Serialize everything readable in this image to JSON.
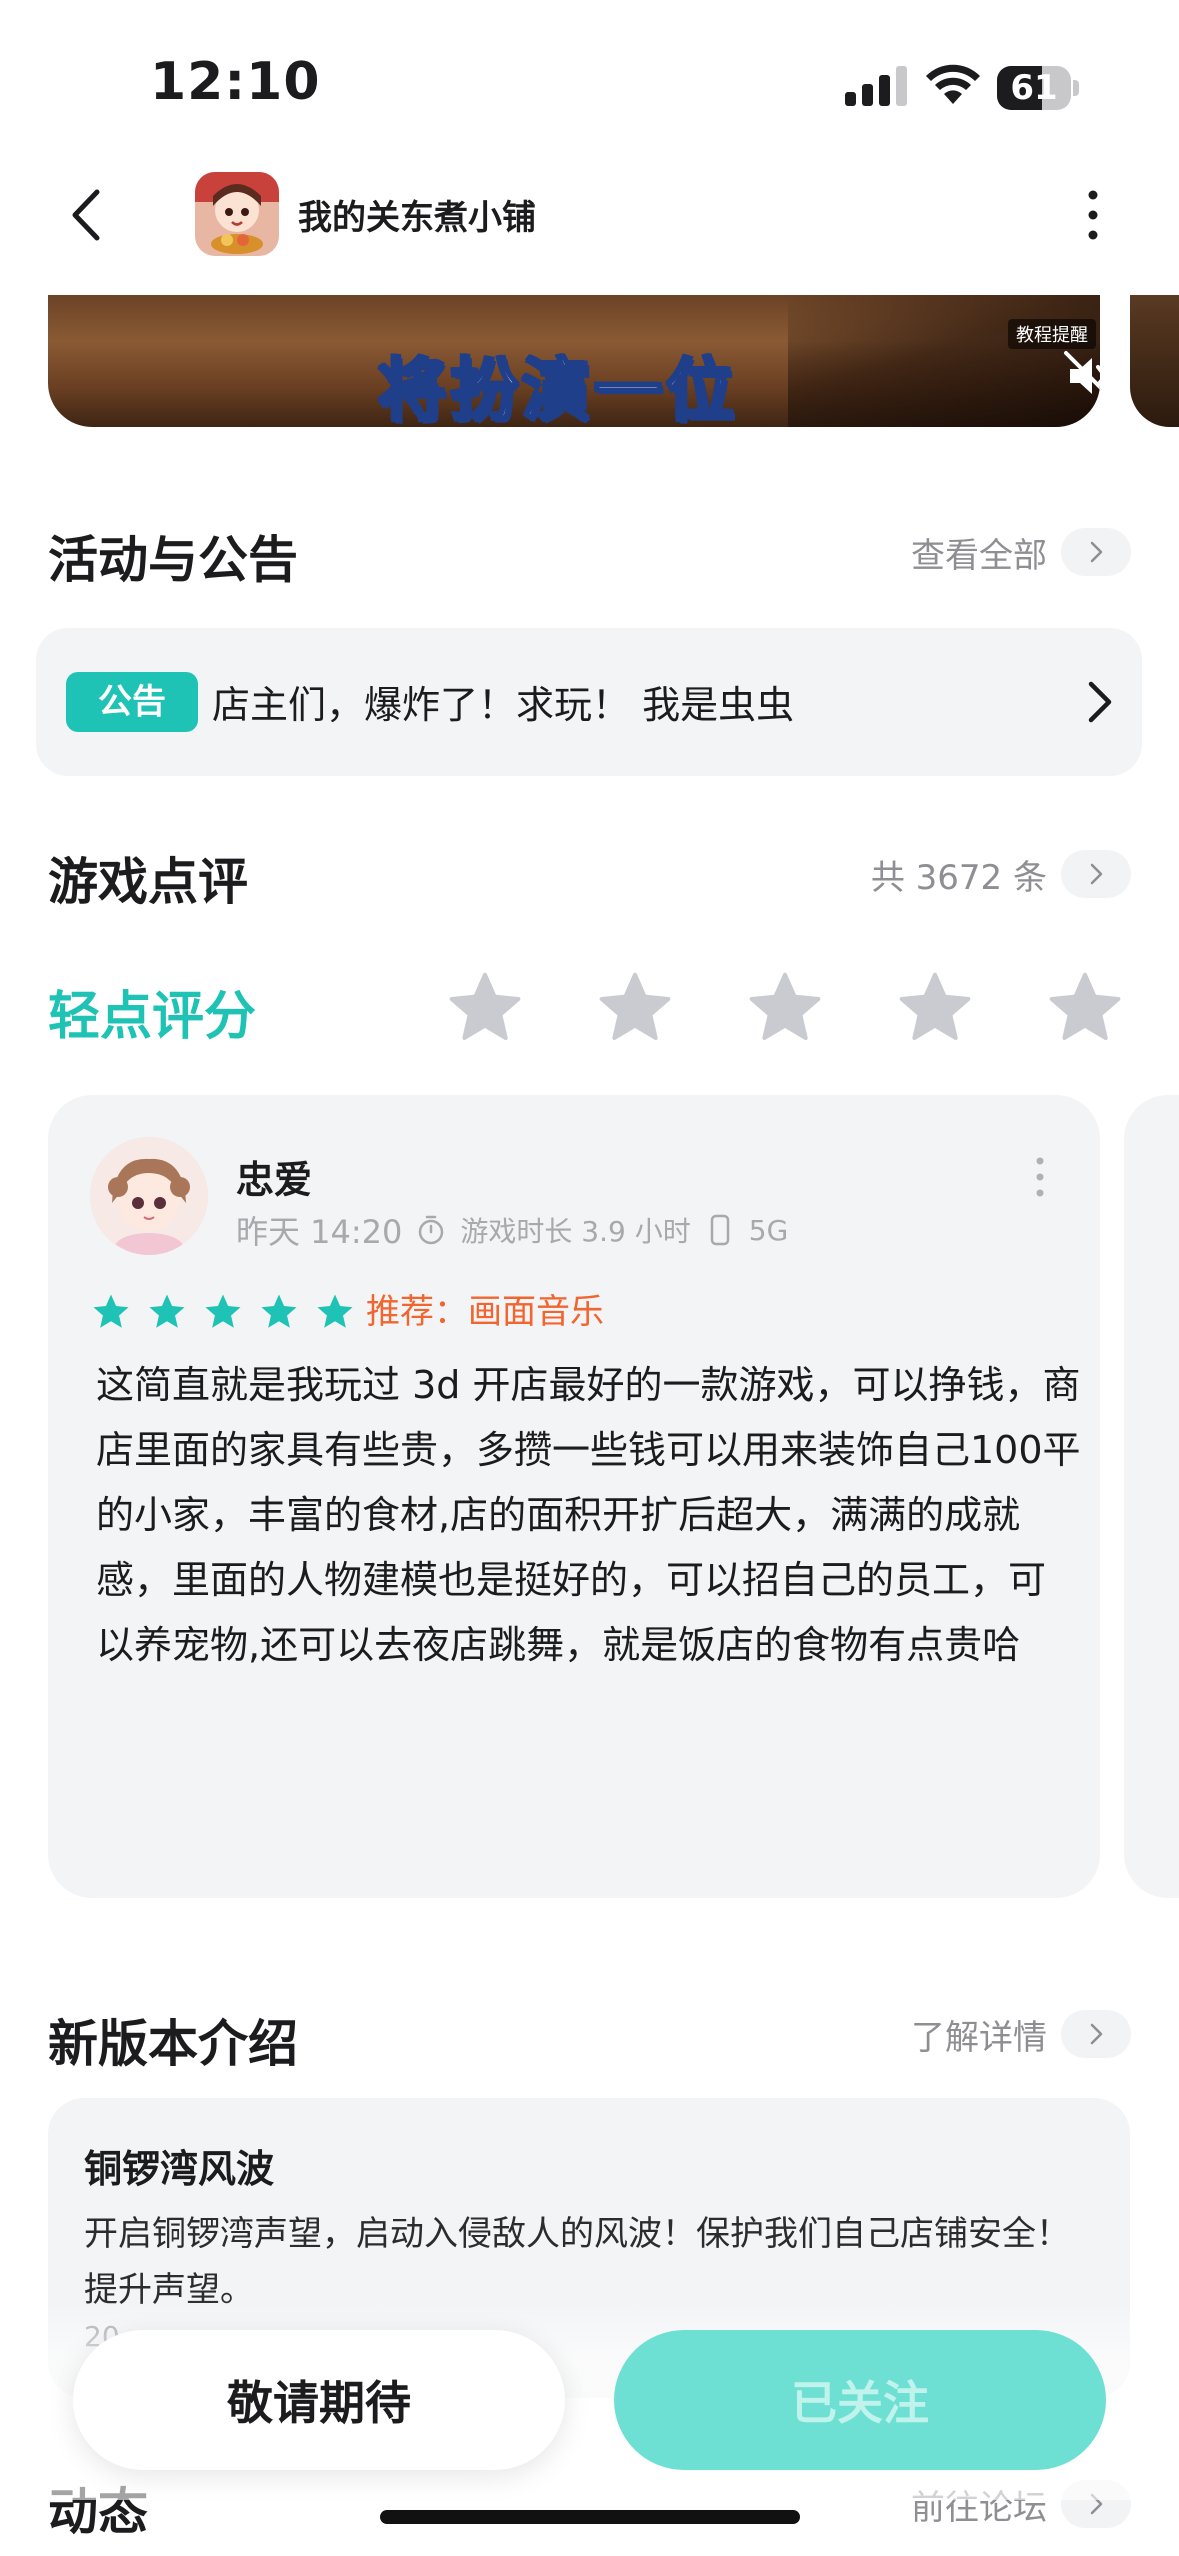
{
  "status_bar": {
    "time": "12:10",
    "battery_level": "61"
  },
  "nav": {
    "title": "我的关东煮小铺"
  },
  "banner": {
    "caption": "将扮演一位",
    "tag": "教程提醒"
  },
  "activities": {
    "title": "活动与公告",
    "link": "查看全部",
    "notice_badge": "公告",
    "notice_text": "店主们，爆炸了！求玩！ 我是虫虫"
  },
  "reviews": {
    "title": "游戏点评",
    "count": "共 3672 条",
    "rate_label": "轻点评分",
    "card": {
      "name": "忠爱",
      "time": "昨天 14:20",
      "playtime": "游戏时长 3.9 小时",
      "device": "5G",
      "stars": 5,
      "recommend": "推荐：画面音乐",
      "body": "这简直就是我玩过 3d 开店最好的一款游戏，可以挣钱，商店里面的家具有些贵，多攒一些钱可以用来装饰自己100平的小家，丰富的食材,店的面积开扩后超大，满满的成就感，里面的人物建模也是挺好的，可以招自己的员工，可以养宠物,还可以去夜店跳舞，就是饭店的食物有点贵哈"
    }
  },
  "version": {
    "title": "新版本介绍",
    "link": "了解详情",
    "card_title": "铜锣湾风波",
    "card_desc": "开启铜锣湾声望，启动入侵敌人的风波！保护我们自己店铺安全！提升声望。",
    "card_date": "20"
  },
  "feed": {
    "title": "动态",
    "link": "前往论坛"
  },
  "actions": {
    "wait_label": "敬请期待",
    "follow_label": "已关注"
  },
  "colors": {
    "accent": "#1fc3b5",
    "recommend": "#f2652e",
    "follow_button": "#6de0d3"
  }
}
